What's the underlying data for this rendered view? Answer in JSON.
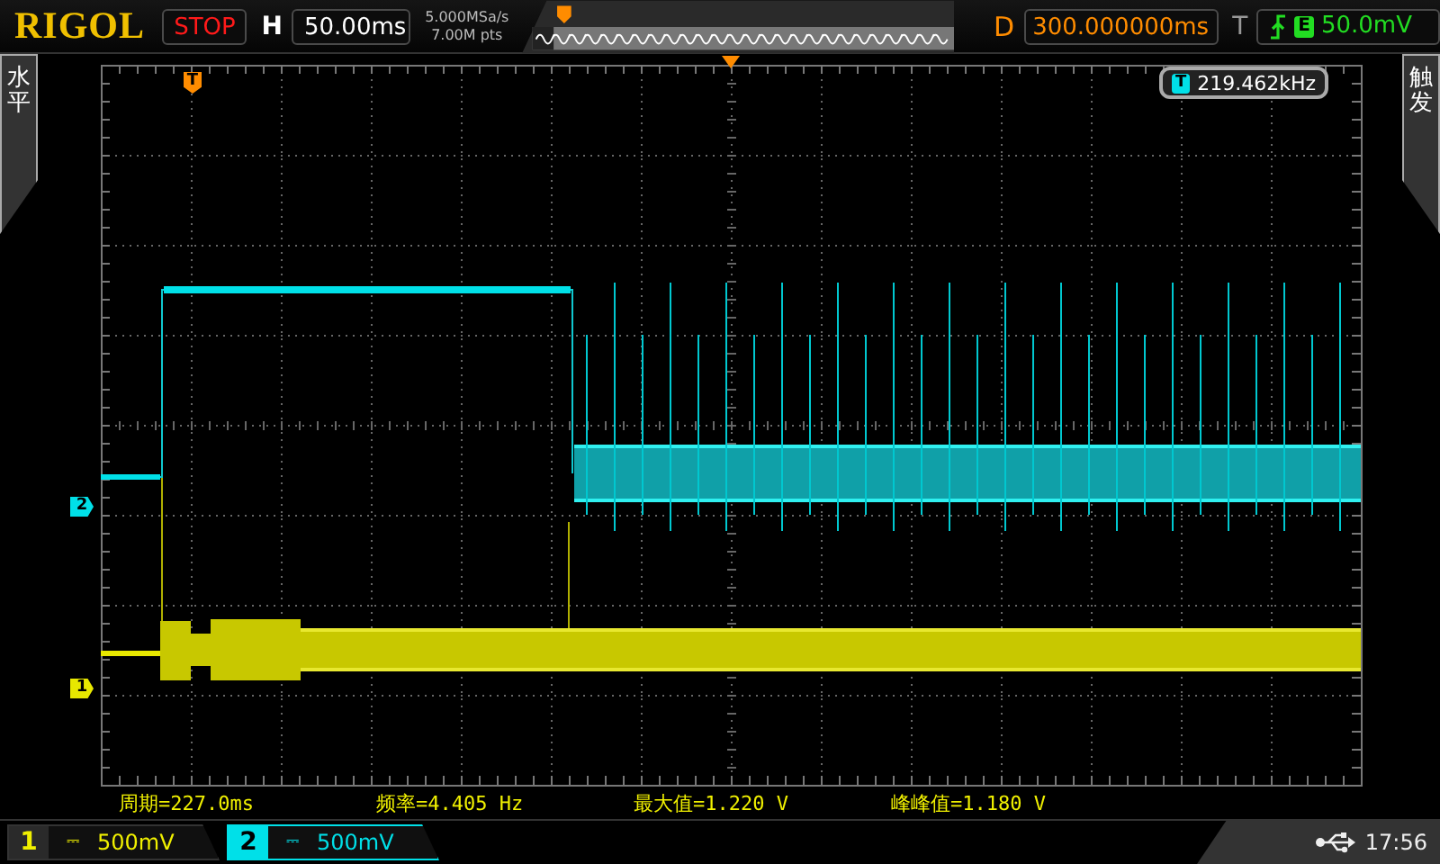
{
  "top_bar": {
    "logo": "RIGOL",
    "run_state": "STOP",
    "timebase": {
      "label": "H",
      "value": "50.00ms"
    },
    "acquisition": {
      "sample_rate": "5.000MSa/s",
      "memory_depth": "7.00M pts"
    },
    "delay": {
      "label": "D",
      "value": "300.000000ms"
    },
    "trigger": {
      "label": "T",
      "source": "E",
      "level": "50.0mV"
    }
  },
  "side_tabs": [
    {
      "label": "水平"
    },
    {
      "label": "触发"
    }
  ],
  "waveform_area": {
    "trigger_marker": "T",
    "frequency_counter": {
      "icon": "T",
      "value": "219.462kHz"
    },
    "channel_markers": [
      {
        "label": "2",
        "color": "#00e0e8"
      },
      {
        "label": "1",
        "color": "#e8e800"
      }
    ]
  },
  "measurements": [
    "周期=227.0ms",
    "频率=4.405 Hz",
    "最大值=1.220 V",
    "峰峰值=1.180 V"
  ],
  "channels": [
    {
      "number": "1",
      "coupling": "⎓",
      "scale": "500mV",
      "selected": false
    },
    {
      "number": "2",
      "coupling": "⎓",
      "scale": "500mV",
      "selected": true
    }
  ],
  "status": {
    "time": "17:56"
  }
}
